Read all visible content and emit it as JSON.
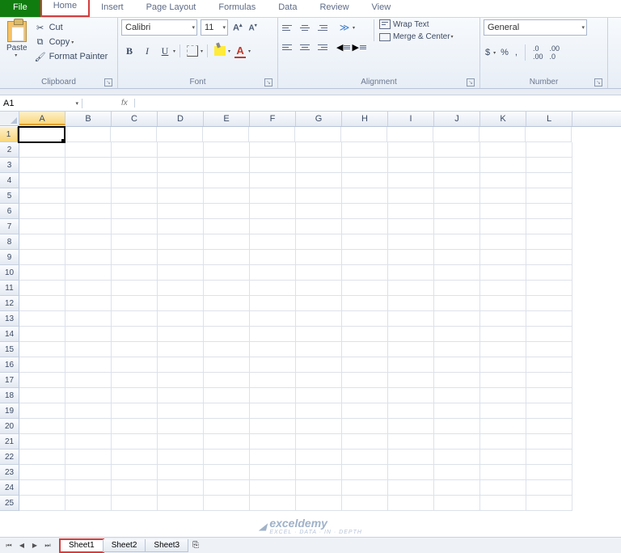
{
  "tabs": {
    "file": "File",
    "home": "Home",
    "insert": "Insert",
    "pageLayout": "Page Layout",
    "formulas": "Formulas",
    "data": "Data",
    "review": "Review",
    "view": "View"
  },
  "clipboard": {
    "paste": "Paste",
    "cut": "Cut",
    "copy": "Copy",
    "painter": "Format Painter",
    "label": "Clipboard"
  },
  "font": {
    "name": "Calibri",
    "size": "11",
    "label": "Font"
  },
  "alignment": {
    "wrap": "Wrap Text",
    "merge": "Merge & Center",
    "label": "Alignment"
  },
  "number": {
    "format": "General",
    "label": "Number"
  },
  "namebox": "A1",
  "columns": [
    "A",
    "B",
    "C",
    "D",
    "E",
    "F",
    "G",
    "H",
    "I",
    "J",
    "K",
    "L"
  ],
  "rowCount": 25,
  "activeCell": {
    "row": 1,
    "col": 0
  },
  "sheets": {
    "s1": "Sheet1",
    "s2": "Sheet2",
    "s3": "Sheet3"
  },
  "watermark": {
    "main": "exceldemy",
    "sub": "EXCEL · DATA · IN · DEPTH"
  }
}
